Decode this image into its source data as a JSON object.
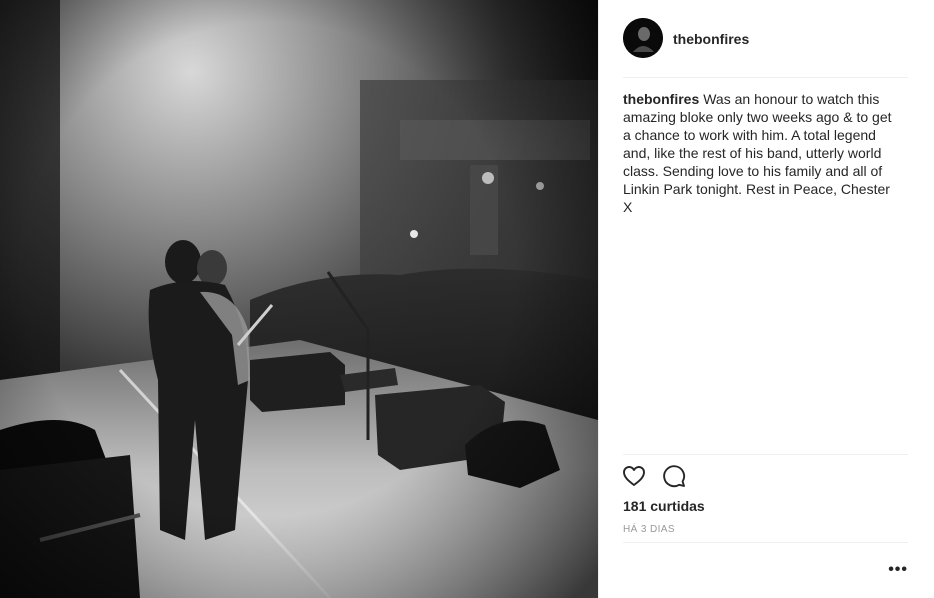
{
  "post": {
    "username": "thebonfires",
    "caption_user": "thebonfires",
    "caption_text": "Was an honour to watch this amazing bloke only two weeks ago & to get a chance to work with him. A total legend and, like the rest of his band, utterly world class. Sending love to his family and all of Linkin Park tonight. Rest in Peace, Chester X",
    "likes": "181 curtidas",
    "timestamp": "HÁ 3 DIAS",
    "more_label": "•••"
  },
  "icons": {
    "like": "heart-icon",
    "comment": "comment-icon",
    "more": "more-options-icon"
  },
  "colors": {
    "text": "#262626",
    "muted": "#999999",
    "divider": "#efefef"
  }
}
